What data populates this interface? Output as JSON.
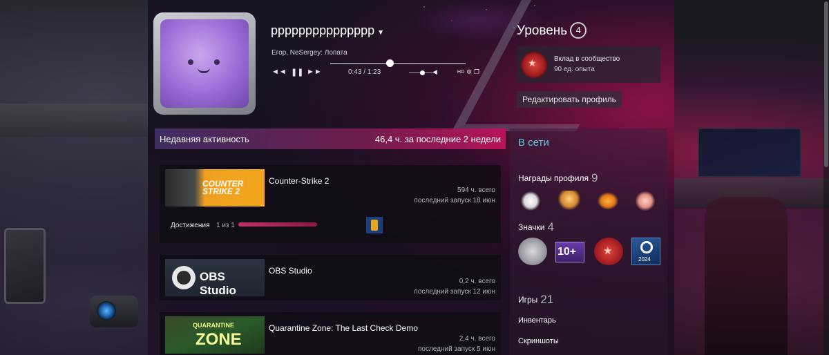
{
  "profile": {
    "username": "ppppppppppppppp",
    "caret": "▼"
  },
  "player": {
    "track": "Егор, NeSergey: Лопата",
    "time": "0:43 / 1:23",
    "rewind": "◄◄",
    "pause": "❚❚",
    "forward": "►►",
    "volume_icon": "◀",
    "hd": "HD",
    "settings_icon": "⚙",
    "popout_icon": "❐",
    "progress": 0.44,
    "volume": 0.55
  },
  "level": {
    "title": "Уровень",
    "value": "4"
  },
  "favorite_badge": {
    "name": "Вклад в сообщество",
    "xp": "90 ед. опыта"
  },
  "edit_profile_label": "Редактировать профиль",
  "activity": {
    "title": "Недавняя активность",
    "summary": "46,4 ч. за последние 2 недели",
    "games": [
      {
        "name": "Counter-Strike 2",
        "capsule_text": "COUNTER STRIKE 2",
        "hours": "594 ч. всего",
        "last_played": "последний запуск 18 июн",
        "achievements_label": "Достижения",
        "achievements_count": "1 из 1",
        "achievements_progress": 1.0
      },
      {
        "name": "OBS Studio",
        "capsule_text": "OBS Studio",
        "hours": "0,2 ч. всего",
        "last_played": "последний запуск 12 июн"
      },
      {
        "name": "Quarantine Zone: The Last Check Demo",
        "capsule_top": "QUARANTINE",
        "capsule_main": "ZONE",
        "hours": "2,4 ч. всего",
        "last_played": "последний запуск 5 июн"
      }
    ]
  },
  "sidebar": {
    "status": "В сети",
    "awards_label": "Награды профиля",
    "awards_count": "9",
    "badges_label": "Значки",
    "badges_count": "4",
    "badge_10_text": "10+",
    "badge_year_text": "2024",
    "games_label": "Игры",
    "games_count": "21",
    "inventory_label": "Инвентарь",
    "screenshots_label": "Скриншоты"
  },
  "colors": {
    "online": "#57cbde",
    "accent_pink": "#be145a"
  }
}
